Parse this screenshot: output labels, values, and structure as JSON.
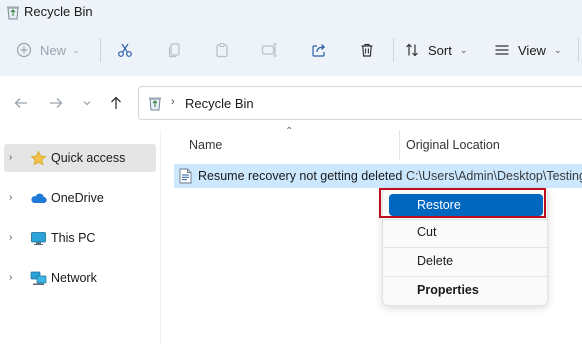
{
  "window": {
    "title": "Recycle Bin"
  },
  "toolbar": {
    "new_label": "New",
    "sort_label": "Sort",
    "view_label": "View"
  },
  "navigation": {
    "address": "Recycle Bin"
  },
  "sidebar": {
    "items": [
      {
        "label": "Quick access",
        "icon": "star-icon"
      },
      {
        "label": "OneDrive",
        "icon": "cloud-icon"
      },
      {
        "label": "This PC",
        "icon": "monitor-icon"
      },
      {
        "label": "Network",
        "icon": "network-icon"
      }
    ]
  },
  "columns": {
    "name": "Name",
    "original_location": "Original Location"
  },
  "files": [
    {
      "name": "Resume recovery not getting deleted",
      "location": "C:\\Users\\Admin\\Desktop\\Testing"
    }
  ],
  "context_menu": {
    "restore": "Restore",
    "cut": "Cut",
    "delete": "Delete",
    "properties": "Properties"
  },
  "colors": {
    "accent": "#0067c0",
    "selection": "#cce8ff",
    "highlight_border": "#c00a1d",
    "chrome": "#eef3fa"
  }
}
